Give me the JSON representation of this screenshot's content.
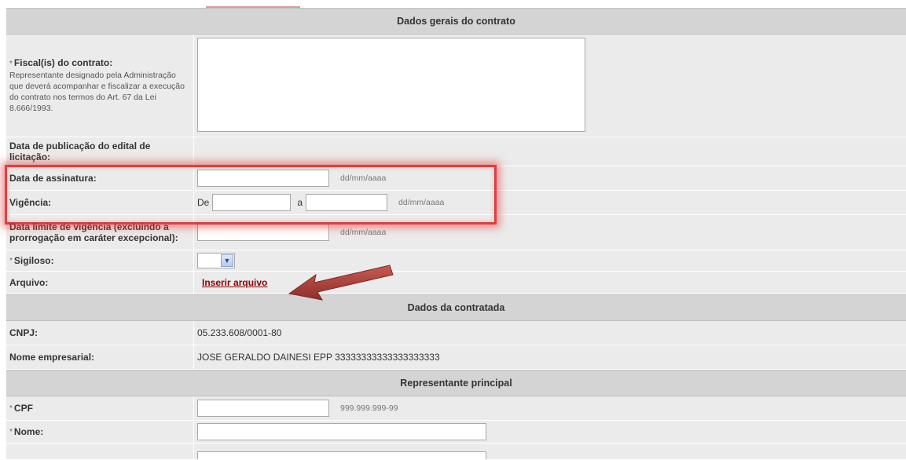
{
  "sections": {
    "contract": "Dados gerais do contrato",
    "contractor": "Dados da contratada",
    "rep": "Representante principal"
  },
  "fiscal": {
    "required": "*",
    "label": "Fiscal(is) do contrato:",
    "desc": "Representante designado pela Administração que deverá acompanhar e fiscalizar a execução do contrato nos termos do Art. 67 da Lei 8.666/1993.",
    "value": ""
  },
  "publication_date": {
    "label": "Data de publicação do edital de licitação:"
  },
  "signature_date": {
    "label": "Data de assinatura:",
    "value": "",
    "hint": "dd/mm/aaaa"
  },
  "validity": {
    "label": "Vigência:",
    "from_label": "De",
    "from_value": "",
    "to_label": "a",
    "to_value": "",
    "hint": "dd/mm/aaaa"
  },
  "limit_date": {
    "label": "Data limite de vigência (excluindo a prorrogação em caráter excepcional):",
    "value": "",
    "hint": "dd/mm/aaaa"
  },
  "confidential": {
    "required": "*",
    "label": "Sigiloso:",
    "selected": ""
  },
  "file": {
    "label": "Arquivo:",
    "link": "Inserir arquivo"
  },
  "cnpj": {
    "label": "CNPJ:",
    "value": "05.233.608/0001-80"
  },
  "company": {
    "label": "Nome empresarial:",
    "value": "JOSE GERALDO DAINESI EPP 33333333333333333333"
  },
  "cpf": {
    "required": "*",
    "label": "CPF",
    "value": "",
    "hint": "999.999.999-99"
  },
  "name": {
    "required": "*",
    "label": "Nome:",
    "value": ""
  },
  "colors": {
    "highlight": "#dc1e1e",
    "arrow": "#b3413a",
    "link": "#8b0000"
  }
}
